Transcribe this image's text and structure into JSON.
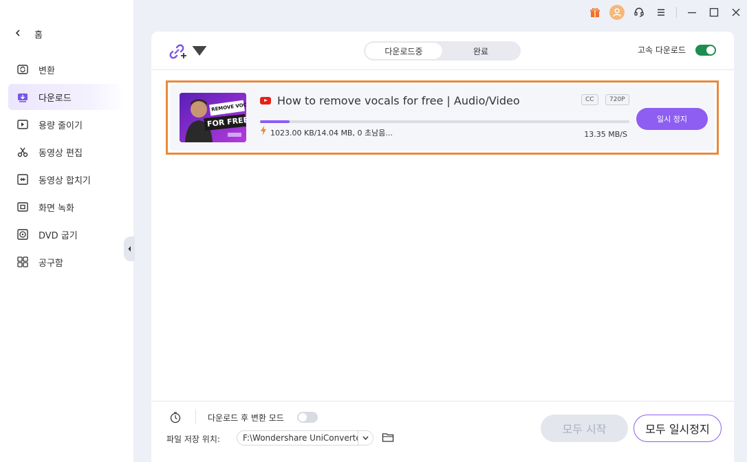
{
  "sidebar": {
    "home_label": "홈",
    "items": [
      {
        "label": "변환",
        "icon": "convert-icon"
      },
      {
        "label": "다운로드",
        "icon": "download-icon"
      },
      {
        "label": "용량 줄이기",
        "icon": "compress-icon"
      },
      {
        "label": "동영상 편집",
        "icon": "scissors-icon"
      },
      {
        "label": "동영상 합치기",
        "icon": "merge-icon"
      },
      {
        "label": "화면 녹화",
        "icon": "screen-record-icon"
      },
      {
        "label": "DVD 굽기",
        "icon": "dvd-icon"
      },
      {
        "label": "공구함",
        "icon": "toolbox-icon"
      }
    ],
    "active_index": 1
  },
  "titlebar": {
    "icons": [
      "gift-icon",
      "avatar-icon",
      "headset-icon",
      "menu-icon",
      "minimize-icon",
      "maximize-icon",
      "close-icon"
    ]
  },
  "topbar": {
    "tabs": [
      "다운로드중",
      "완료"
    ],
    "active_tab": 0,
    "high_speed_label": "고속 다운로드",
    "high_speed_on": true
  },
  "download": {
    "title": "How to remove vocals for free | Audio/Video",
    "badge_cc": "CC",
    "badge_quality": "720P",
    "progress_fraction": 0.08,
    "meta": "1023.00 KB/14.04 MB, 0 초남음...",
    "speed": "13.35 MB/S",
    "pause_label": "일시 정지",
    "thumbnail_text_1": "REMOVE VOCALS",
    "thumbnail_text_2": "FOR FREE"
  },
  "bottom": {
    "convert_mode_label": "다운로드 후 변환 모드",
    "convert_mode_on": false,
    "save_location_label": "파일 저장 위치:",
    "save_path": "F:\\Wondershare UniConverter",
    "start_all_label": "모두 시작",
    "pause_all_label": "모두 일시정지"
  },
  "colors": {
    "accent": "#8e5df2",
    "highlight_border": "#e8893a",
    "toggle_on": "#1e8e4e"
  }
}
